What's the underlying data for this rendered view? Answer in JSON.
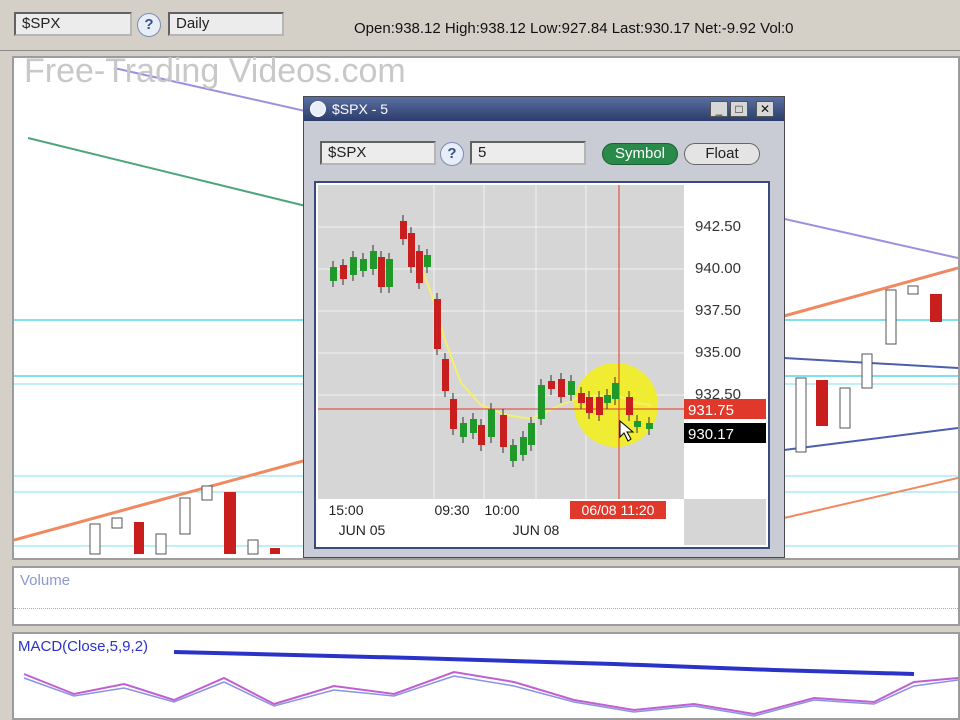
{
  "toolbar": {
    "symbol": "$SPX",
    "help": "?",
    "interval": "Daily",
    "quote": "Open:938.12  High:938.12  Low:927.84  Last:930.17  Net:-9.92  Vol:0"
  },
  "watermark": "Free-Trading Videos.com",
  "popup": {
    "title": "$SPX - 5",
    "symbol": "$SPX",
    "help": "?",
    "interval": "5",
    "symbol_button": "Symbol",
    "float_button": "Float",
    "price_labels": [
      "942.50",
      "940.00",
      "937.50",
      "935.00",
      "932.50"
    ],
    "crosshair_price": "931.75",
    "last_price": "930.17",
    "time_labels": [
      "15:00",
      "09:30",
      "10:00"
    ],
    "date_labels": [
      "JUN 05",
      "JUN 08"
    ],
    "crosshair_time": "06/08 11:20",
    "colors": {
      "up": "#1f9a2a",
      "down": "#c81e1e",
      "crosshair": "#e0392b",
      "highlight": "#f2ee20"
    }
  },
  "volume_pane": {
    "label": "Volume"
  },
  "macd_pane": {
    "label": "MACD(Close,5,9,2)"
  }
}
